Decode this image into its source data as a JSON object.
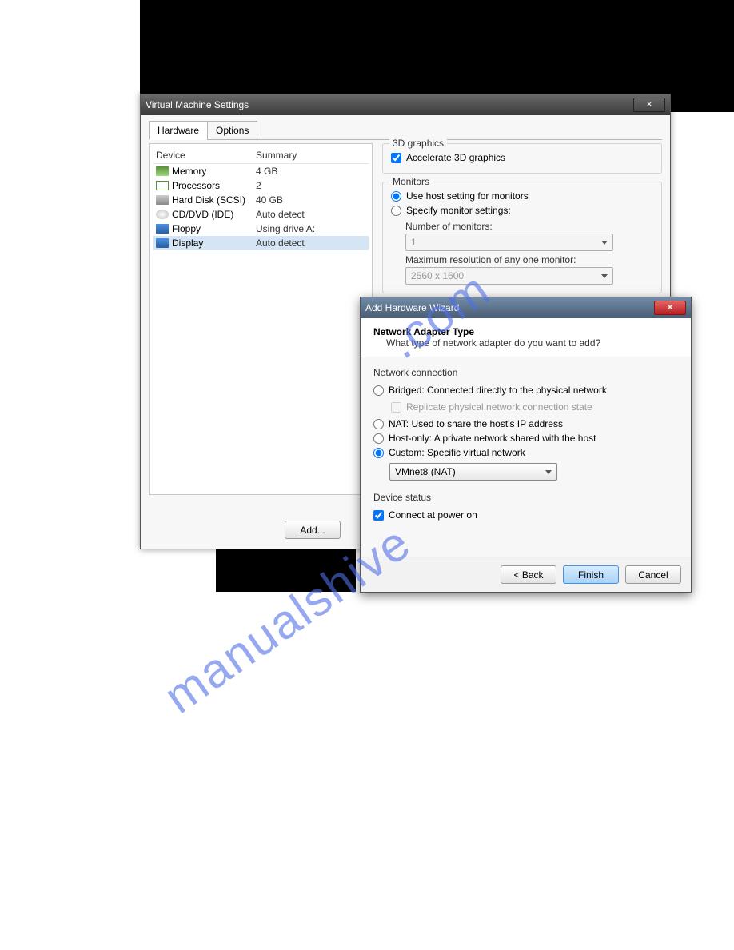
{
  "main": {
    "title": "Virtual Machine Settings",
    "tabs": {
      "hardware": "Hardware",
      "options": "Options"
    },
    "headers": {
      "device": "Device",
      "summary": "Summary"
    },
    "devices": [
      {
        "name": "Memory",
        "summary": "4 GB",
        "icon": "mem"
      },
      {
        "name": "Processors",
        "summary": "2",
        "icon": "proc"
      },
      {
        "name": "Hard Disk (SCSI)",
        "summary": "40 GB",
        "icon": "hd"
      },
      {
        "name": "CD/DVD (IDE)",
        "summary": "Auto detect",
        "icon": "cd"
      },
      {
        "name": "Floppy",
        "summary": "Using drive A:",
        "icon": "floppy"
      },
      {
        "name": "Display",
        "summary": "Auto detect",
        "icon": "disp"
      }
    ],
    "graphics": {
      "title": "3D graphics",
      "accel": "Accelerate 3D graphics"
    },
    "monitors": {
      "title": "Monitors",
      "usehost": "Use host setting for monitors",
      "specify": "Specify monitor settings:",
      "num_label": "Number of monitors:",
      "num_value": "1",
      "max_label": "Maximum resolution of any one monitor:",
      "max_value": "2560 x 1600"
    },
    "add_btn": "Add..."
  },
  "wizard": {
    "title": "Add Hardware Wizard",
    "header": "Network Adapter Type",
    "sub": "What type of network adapter do you want to add?",
    "conn_title": "Network connection",
    "bridged": "Bridged: Connected directly to the physical network",
    "replicate": "Replicate physical network connection state",
    "nat": "NAT: Used to share the host's IP address",
    "hostonly": "Host-only: A private network shared with the host",
    "custom": "Custom: Specific virtual network",
    "custom_value": "VMnet8 (NAT)",
    "status_title": "Device status",
    "connect": "Connect at power on",
    "back": "< Back",
    "finish": "Finish",
    "cancel": "Cancel"
  }
}
